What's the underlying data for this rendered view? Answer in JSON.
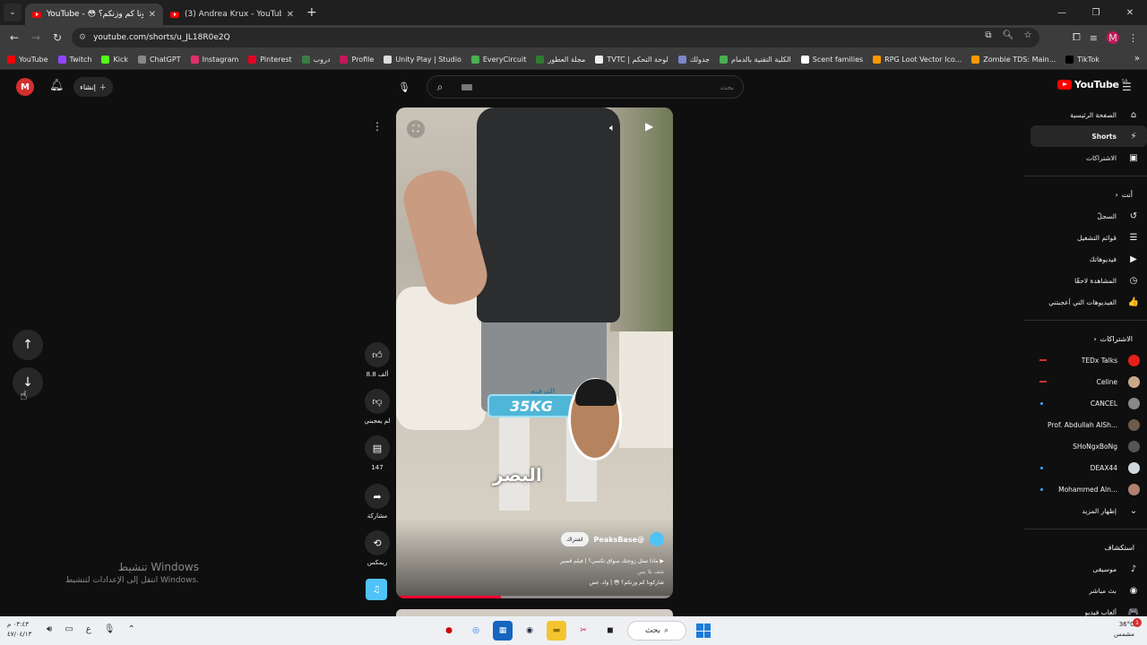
{
  "browser": {
    "tabs": [
      {
        "title": "YouTube - 😳 شاركونا كم وزنكم؟"
      },
      {
        "title": "(3) Andrea Krux - YouTube"
      }
    ],
    "url": "youtube.com/shorts/u_JL18R0e2Q",
    "profile_initial": "M"
  },
  "bookmarks": [
    {
      "label": "YouTube",
      "color": "#ff0000"
    },
    {
      "label": "Twitch",
      "color": "#9146ff"
    },
    {
      "label": "Kick",
      "color": "#53fc18"
    },
    {
      "label": "ChatGPT",
      "color": "#888888"
    },
    {
      "label": "Instagram",
      "color": "#e1306c"
    },
    {
      "label": "Pinterest",
      "color": "#e60023"
    },
    {
      "label": "دروب",
      "color": "#3a7d44"
    },
    {
      "label": "Profile",
      "color": "#c2185b"
    },
    {
      "label": "Unity Play | Studio",
      "color": "#dddddd"
    },
    {
      "label": "EveryCircuit",
      "color": "#4caf50"
    },
    {
      "label": "مجلة العطور",
      "color": "#2e7d32"
    },
    {
      "label": "TVTC | لوحة التحكم",
      "color": "#eeeeee"
    },
    {
      "label": "جدولك",
      "color": "#7986cb"
    },
    {
      "label": "الكلية التقنية بالدمام",
      "color": "#4caf50"
    },
    {
      "label": "Scent families",
      "color": "#ffffff"
    },
    {
      "label": "RPG Loot Vector Ico...",
      "color": "#ff9800"
    },
    {
      "label": "Zombie TDS: Main...",
      "color": "#ff9800"
    },
    {
      "label": "TikTok",
      "color": "#000000"
    }
  ],
  "header": {
    "avatar_initial": "M",
    "create_label": "إنشاء",
    "search_placeholder": "بحث",
    "logo_text": "YouTube",
    "logo_region": "SA"
  },
  "sidebar": {
    "main": [
      {
        "label": "الصفحة الرئيسية",
        "icon": "home-icon",
        "glyph": "⌂"
      },
      {
        "label": "Shorts",
        "icon": "shorts-icon",
        "glyph": "⚡",
        "active": true
      },
      {
        "label": "الاشتراكات",
        "icon": "subscriptions-icon",
        "glyph": "▣"
      }
    ],
    "you_heading": "أنت",
    "you": [
      {
        "label": "السجلّ",
        "icon": "history-icon",
        "glyph": "↺"
      },
      {
        "label": "قوائم التشغيل",
        "icon": "playlists-icon",
        "glyph": "☰"
      },
      {
        "label": "فيديوهاتك",
        "icon": "your-videos-icon",
        "glyph": "▶"
      },
      {
        "label": "المشاهدة لاحقًا",
        "icon": "watch-later-icon",
        "glyph": "◷"
      },
      {
        "label": "الفيديوهات التي أعجبتني",
        "icon": "liked-icon",
        "glyph": "👍"
      }
    ],
    "subs_heading": "الاشتراكات",
    "subscriptions": [
      {
        "label": "TEDx Talks",
        "color": "#e62117",
        "marker": "red"
      },
      {
        "label": "Celine",
        "color": "#c9a88a",
        "marker": "red"
      },
      {
        "label": "CANCEL",
        "color": "#888888",
        "marker": "dot"
      },
      {
        "label": "Prof. Abdullah AlSh...",
        "color": "#6d5a4a",
        "marker": ""
      },
      {
        "label": "SHoNgxBoNg",
        "color": "#555555",
        "marker": ""
      },
      {
        "label": "DEAX44",
        "color": "#cfd8dc",
        "marker": "dot"
      },
      {
        "label": "Mohammed Aln...",
        "color": "#b08070",
        "marker": "dot"
      }
    ],
    "show_more": "إظهار المزيد",
    "explore_heading": "استكشاف",
    "explore": [
      {
        "label": "موسيقى",
        "icon": "music-icon",
        "glyph": "♪"
      },
      {
        "label": "بث مباشر",
        "icon": "live-icon",
        "glyph": "◉"
      },
      {
        "label": "ألعاب فيديو",
        "icon": "gaming-icon",
        "glyph": "🎮"
      }
    ]
  },
  "short": {
    "badge_top": "الترفيه",
    "badge_kg": "35KG",
    "overlay_text": "البصر",
    "channel": "@PeaksBase",
    "subscribe_label": "اشتراك",
    "song": "ماذا تمثل زوجتك سواق تكسي؟ | فيلم قصير",
    "caption_line1": "شف بلا بس",
    "caption_line2": "شاركونا كم وزنكم؟ 😳 | واد. غض",
    "progress_percent": 38
  },
  "actions": {
    "like_count": "8.8 ألف",
    "dislike_label": "لم يعجبني",
    "comment_count": "147",
    "share_label": "مشاركة",
    "remix_label": "ريمكس"
  },
  "activation": {
    "line1": "تنشيط Windows",
    "line2": "انتقل إلى الإعدادات لتنشيط Windows."
  },
  "taskbar": {
    "time": "٠٣:٤٣ م",
    "date": "٤٧/٠٤/١٣",
    "lang": "ع",
    "search_label": "بحث",
    "temperature": "36°C",
    "weather": "مشمس",
    "notif_count": "1"
  }
}
